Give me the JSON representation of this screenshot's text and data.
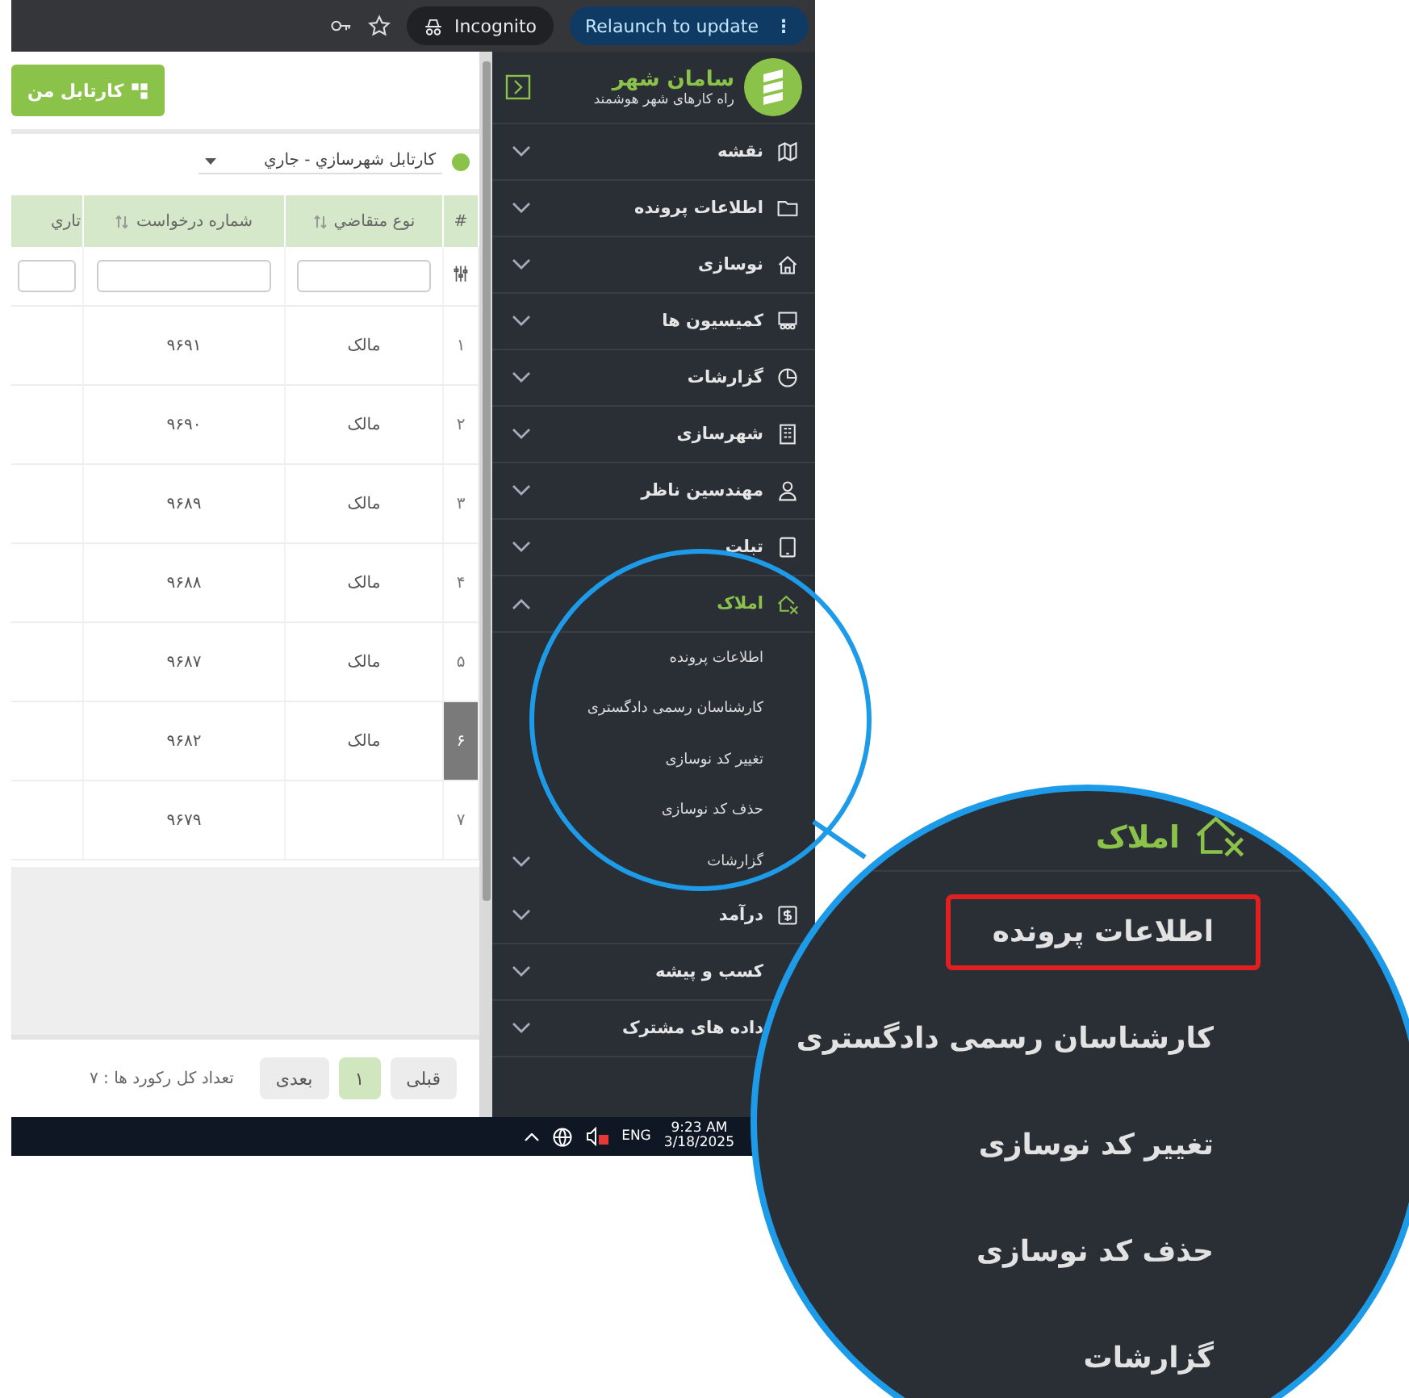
{
  "browser_bar": {
    "incognito": "Incognito",
    "relaunch": "Relaunch to update",
    "menu": "⋮"
  },
  "toolbar": {
    "cartable_button": "کارتابل من"
  },
  "cartable_select": {
    "value": "کارتابل شهرسازي - جاري"
  },
  "table": {
    "columns": [
      "#",
      "نوع متقاضي",
      "شماره درخواست",
      "تاري"
    ],
    "rows": [
      {
        "cells": [
          "۱",
          "مالک",
          "۹۶۹۱"
        ],
        "selected": false
      },
      {
        "cells": [
          "۲",
          "مالک",
          "۹۶۹۰"
        ],
        "selected": false
      },
      {
        "cells": [
          "۳",
          "مالک",
          "۹۶۸۹"
        ],
        "selected": false
      },
      {
        "cells": [
          "۴",
          "مالک",
          "۹۶۸۸"
        ],
        "selected": false
      },
      {
        "cells": [
          "۵",
          "مالک",
          "۹۶۸۷"
        ],
        "selected": false
      },
      {
        "cells": [
          "۶",
          "مالک",
          "۹۶۸۲"
        ],
        "selected": true
      },
      {
        "cells": [
          "۷",
          "",
          "۹۶۷۹"
        ],
        "selected": false
      }
    ]
  },
  "pagination": {
    "previous": "قبلی",
    "pages": [
      {
        "label": "۱",
        "selected": true
      }
    ],
    "next": "بعدی",
    "total": "تعداد کل رکورد ها : ۷"
  },
  "sidebar": {
    "title": "سامان شهر",
    "subtitle": "راه کارهای شهر هوشمند",
    "items": [
      {
        "label": "نقشه",
        "expanded": false
      },
      {
        "label": "اطلاعات پرونده",
        "expanded": false
      },
      {
        "label": "نوسازی",
        "expanded": false
      },
      {
        "label": "کمیسیون ها",
        "expanded": false
      },
      {
        "label": "گزارشات",
        "expanded": false
      },
      {
        "label": "شهرسازی",
        "expanded": false
      },
      {
        "label": "مهندسین ناظر",
        "expanded": false
      },
      {
        "label": "تبلت",
        "expanded": false
      },
      {
        "label": "املاک",
        "expanded": true,
        "children": [
          {
            "label": "اطلاعات پرونده",
            "kind": "link"
          },
          {
            "label": "کارشناسان رسمی دادگستری",
            "kind": "link"
          },
          {
            "label": "تغییر کد نوسازی",
            "kind": "link"
          },
          {
            "label": "حذف کد نوسازی",
            "kind": "link"
          },
          {
            "label": "گزارشات",
            "kind": "group"
          }
        ]
      },
      {
        "label": "درآمد",
        "expanded": false
      },
      {
        "label": "کسب و پیشه",
        "expanded": false
      },
      {
        "label": "داده های مشترک",
        "expanded": false
      }
    ]
  },
  "taskbar": {
    "language": "ENG",
    "time": "9:23 AM",
    "date": "3/18/2025"
  },
  "magnifier": {
    "title": "املاک",
    "items": [
      {
        "label": "اطلاعات پرونده",
        "highlighted": true
      },
      {
        "label": "کارشناسان رسمی دادگستری",
        "highlighted": false
      },
      {
        "label": "تغییر کد نوسازی",
        "highlighted": false
      },
      {
        "label": "حذف کد نوسازی",
        "highlighted": false
      },
      {
        "label": "گزارشات",
        "highlighted": false
      }
    ]
  }
}
